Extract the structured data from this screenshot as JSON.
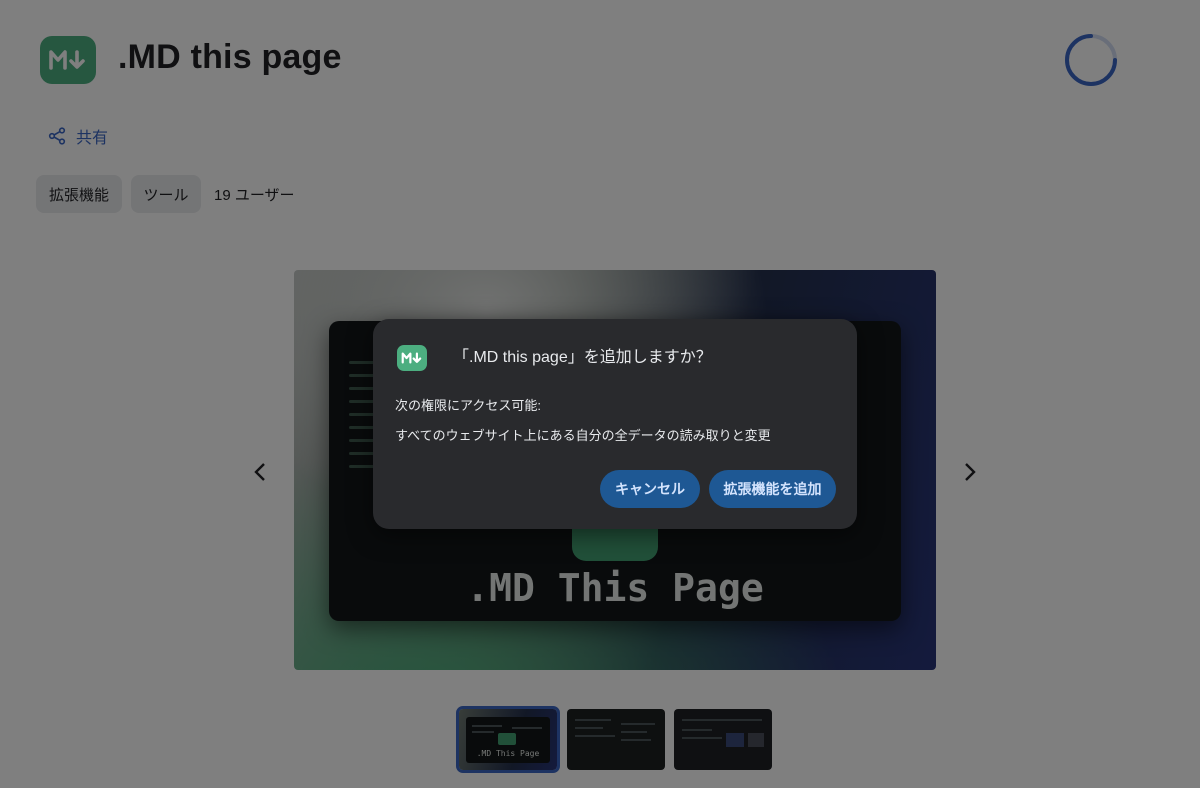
{
  "app": {
    "title": ".MD this page",
    "logo_icon": "markdown-down-arrow-icon",
    "brand_color": "#4cae80"
  },
  "header": {
    "share_label": "共有"
  },
  "chips": {
    "category": "拡張機能",
    "subcategory": "ツール"
  },
  "users_label": "19 ユーザー",
  "carousel": {
    "main_image_text": ".MD This Page",
    "thumbnails": [
      {
        "caption": ".MD This Page",
        "selected": true
      },
      {
        "caption": "",
        "selected": false
      },
      {
        "caption": "",
        "selected": false
      }
    ]
  },
  "dialog": {
    "title": "「.MD this page」を追加しますか？",
    "permissions_heading": "次の権限にアクセス可能:",
    "permission_item": "すべてのウェブサイト上にある自分の全データの読み取りと変更",
    "cancel_label": "キャンセル",
    "add_label": "拡張機能を追加",
    "button_color": "#1e5894"
  },
  "colors": {
    "accent": "#3b66c4",
    "overlay": "rgba(0,0,0,0.5)"
  }
}
